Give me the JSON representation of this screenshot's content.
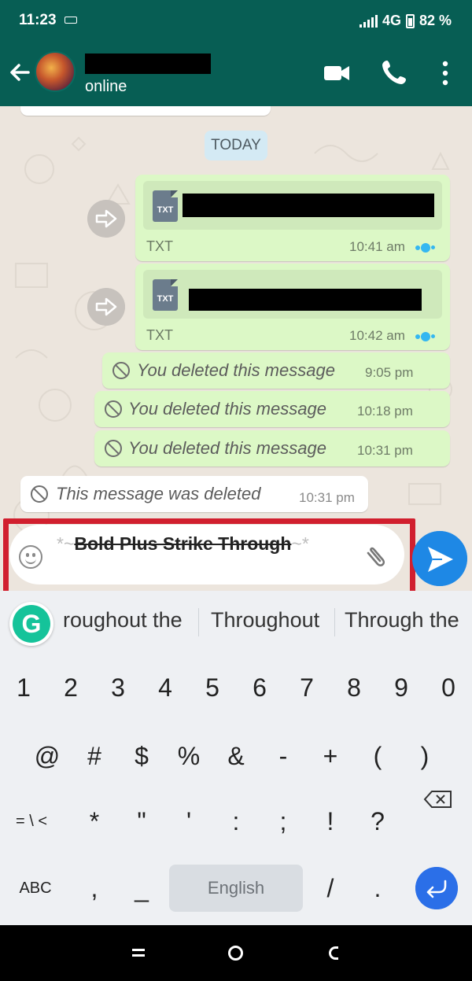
{
  "status_bar": {
    "time": "11:23",
    "network": "4G",
    "battery": "82 %"
  },
  "header": {
    "contact_status": "online"
  },
  "chat": {
    "date_chip": "TODAY",
    "documents": [
      {
        "icon_label": "TXT",
        "type": "TXT",
        "time": "10:41 am"
      },
      {
        "icon_label": "TXT",
        "type": "TXT",
        "time": "10:42 am"
      }
    ],
    "deleted_messages": [
      {
        "text": "You deleted this message",
        "time": "9:05 pm"
      },
      {
        "text": "You deleted this message",
        "time": "10:18 pm"
      },
      {
        "text": "You deleted this message",
        "time": "10:31 pm"
      }
    ],
    "received_deleted": {
      "text": "This message was deleted",
      "time": "10:31 pm"
    }
  },
  "composer": {
    "open_mark": "*~",
    "formatted_text": "Bold Plus Strike Through",
    "close_mark": "~*"
  },
  "keyboard": {
    "suggestions": [
      "roughout the",
      "Throughout",
      "Through the"
    ],
    "number_row": [
      "1",
      "2",
      "3",
      "4",
      "5",
      "6",
      "7",
      "8",
      "9",
      "0"
    ],
    "symbol_row_1": [
      "@",
      "#",
      "$",
      "%",
      "&",
      "-",
      "+",
      "(",
      ")"
    ],
    "symbol_row_2": [
      "= \\ <",
      "*",
      "\"",
      "'",
      ":",
      ";",
      "!",
      "?"
    ],
    "bottom_row": {
      "abc": "ABC",
      "comma": ",",
      "underscore": "_",
      "space": "English",
      "slash": "/",
      "period": "."
    }
  },
  "colors": {
    "header": "#075e54",
    "outgoing_bubble": "#dcf8c6",
    "highlight_outline": "#d11f2e",
    "send_button": "#1e88e5",
    "read_ticks": "#34b7f1",
    "grammarly": "#15c39a"
  }
}
